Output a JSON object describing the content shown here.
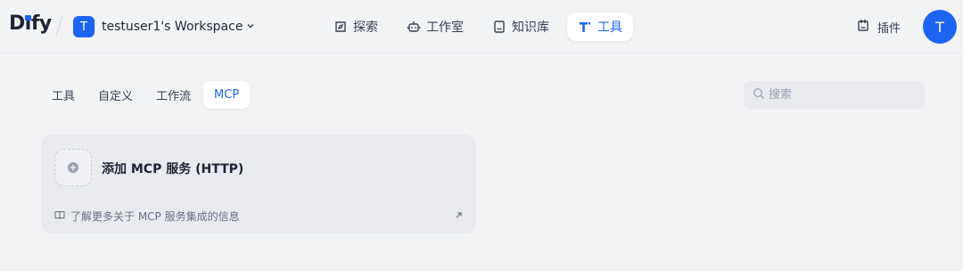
{
  "brand": {
    "logo_text_d": "D",
    "logo_text_i": "ı",
    "logo_text_rest": "fy"
  },
  "workspace": {
    "avatar_letter": "T",
    "name": "testuser1's Workspace"
  },
  "nav": [
    {
      "label": "探索",
      "icon": "compass-icon"
    },
    {
      "label": "工作室",
      "icon": "robot-icon"
    },
    {
      "label": "知识库",
      "icon": "book-icon"
    },
    {
      "label": "工具",
      "icon": "tools-icon",
      "active": true
    }
  ],
  "plugins": {
    "label": "插件",
    "icon": "plugin-box-icon"
  },
  "user": {
    "avatar_letter": "T"
  },
  "subtabs": [
    {
      "label": "工具"
    },
    {
      "label": "自定义"
    },
    {
      "label": "工作流"
    },
    {
      "label": "MCP",
      "active": true
    }
  ],
  "search": {
    "placeholder": "搜索"
  },
  "card": {
    "title": "添加 MCP 服务 (HTTP)",
    "link_text": "了解更多关于 MCP 服务集成的信息"
  },
  "colors": {
    "accent": "#1c64f2",
    "background": "#f2f3f5"
  }
}
